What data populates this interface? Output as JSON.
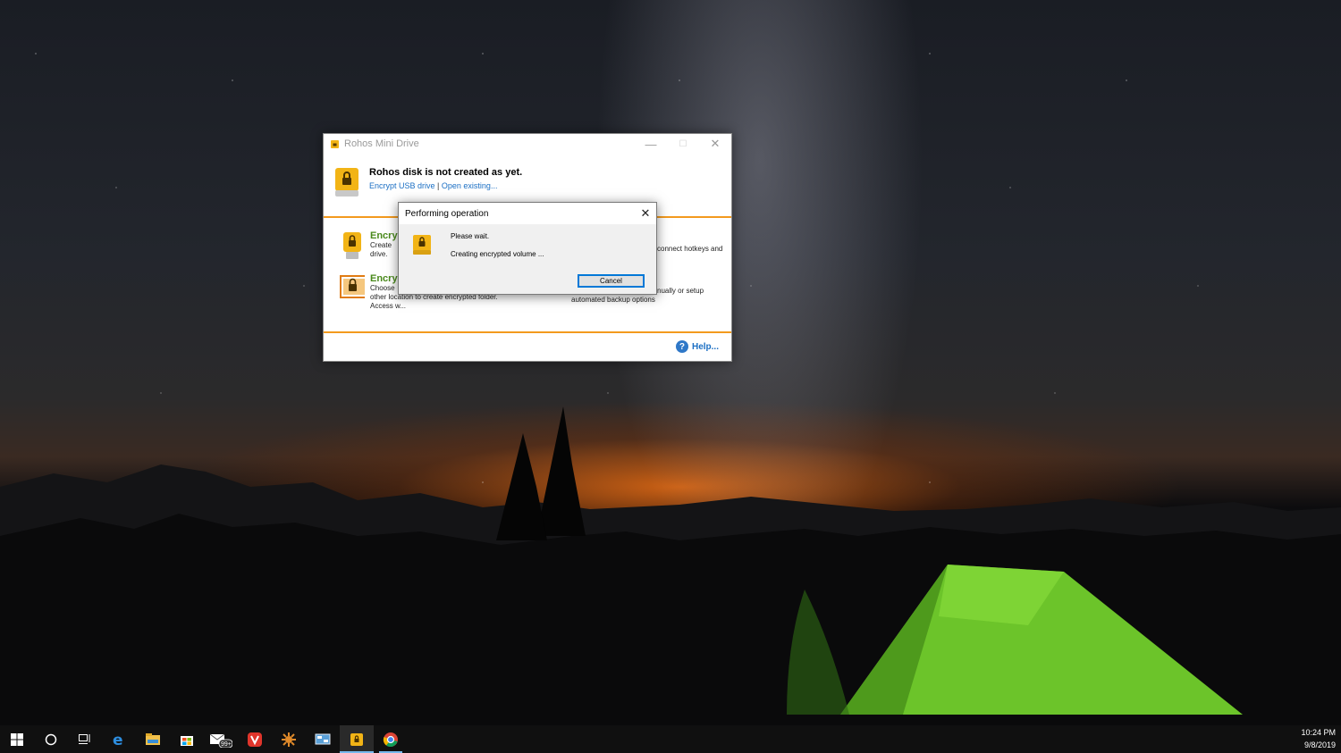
{
  "app": {
    "title": "Rohos Mini Drive",
    "header_title": "Rohos disk is not created as yet.",
    "link_encrypt": "Encrypt USB drive",
    "link_separator": "|",
    "link_open": "Open existing...",
    "option1_title": "Encry",
    "option1_desc_line1": "Create",
    "option1_desc_line2": "drive.",
    "option1_right_text": "connect hotkeys and",
    "option2_title": "Encry",
    "option2_desc_line1": "Choose",
    "option2_desc_line2": "other location to create encrypted folder.",
    "option2_desc_line3": "Access w...",
    "option2_right_line1": "nually or setup",
    "option2_right_line2": "automated backup options",
    "help_label": "Help..."
  },
  "dialog": {
    "title": "Performing operation",
    "close_glyph": "✕",
    "message1": "Please wait.",
    "message2": "Creating encrypted volume ...",
    "cancel_label": "Cancel"
  },
  "window_controls": {
    "minimize": "—",
    "maximize": "☐",
    "close": "✕"
  },
  "taskbar": {
    "time": "10:24 PM",
    "date": "9/8/2019",
    "items": [
      "start-icon",
      "search-icon",
      "task-view-icon",
      "edge-icon",
      "file-explorer-icon",
      "store-icon",
      "mail-icon",
      "vivaldi-icon",
      "app-icon",
      "control-panel-icon",
      "rohos-icon",
      "chrome-icon"
    ],
    "mail_badge": "99+"
  },
  "colors": {
    "accent_orange": "#f39a1e",
    "link_blue": "#1b6fc4",
    "option_green": "#4a8a1c"
  }
}
